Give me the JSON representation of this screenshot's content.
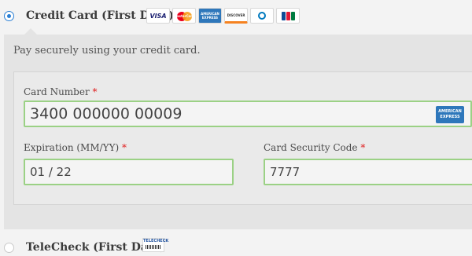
{
  "payment_methods": [
    {
      "label": "Credit Card (First Data)",
      "selected": true,
      "card_logos": [
        {
          "icon": "visa-logo",
          "text": "VISA"
        },
        {
          "icon": "mastercard-logo",
          "text": "MasterCard"
        },
        {
          "icon": "amex-logo",
          "text": "AMERICAN EXPRESS"
        },
        {
          "icon": "discover-logo",
          "text": "DISCOVER"
        },
        {
          "icon": "diners-club-logo",
          "text": ""
        },
        {
          "icon": "jcb-logo",
          "text": ""
        }
      ]
    },
    {
      "label": "TeleCheck (First Data)",
      "selected": false,
      "logo": {
        "icon": "telecheck-logo",
        "text": "TELECHECK"
      }
    }
  ],
  "credit_card_form": {
    "description": "Pay securely using your credit card.",
    "card_number": {
      "label": "Card Number",
      "required_marker": "*",
      "value": "3400 000000 00009",
      "detected_card_icon": "amex-icon",
      "detected_card_text": "AMERICAN EXPRESS"
    },
    "expiration": {
      "label": "Expiration (MM/YY)",
      "required_marker": "*",
      "value": "01 / 22"
    },
    "security_code": {
      "label": "Card Security Code",
      "required_marker": "*",
      "value": "7777"
    }
  },
  "colors": {
    "radio_selected": "#2a7fd4",
    "input_border_valid": "#9bd185",
    "required": "#e02020",
    "panel_bg": "#e4e4e4"
  }
}
